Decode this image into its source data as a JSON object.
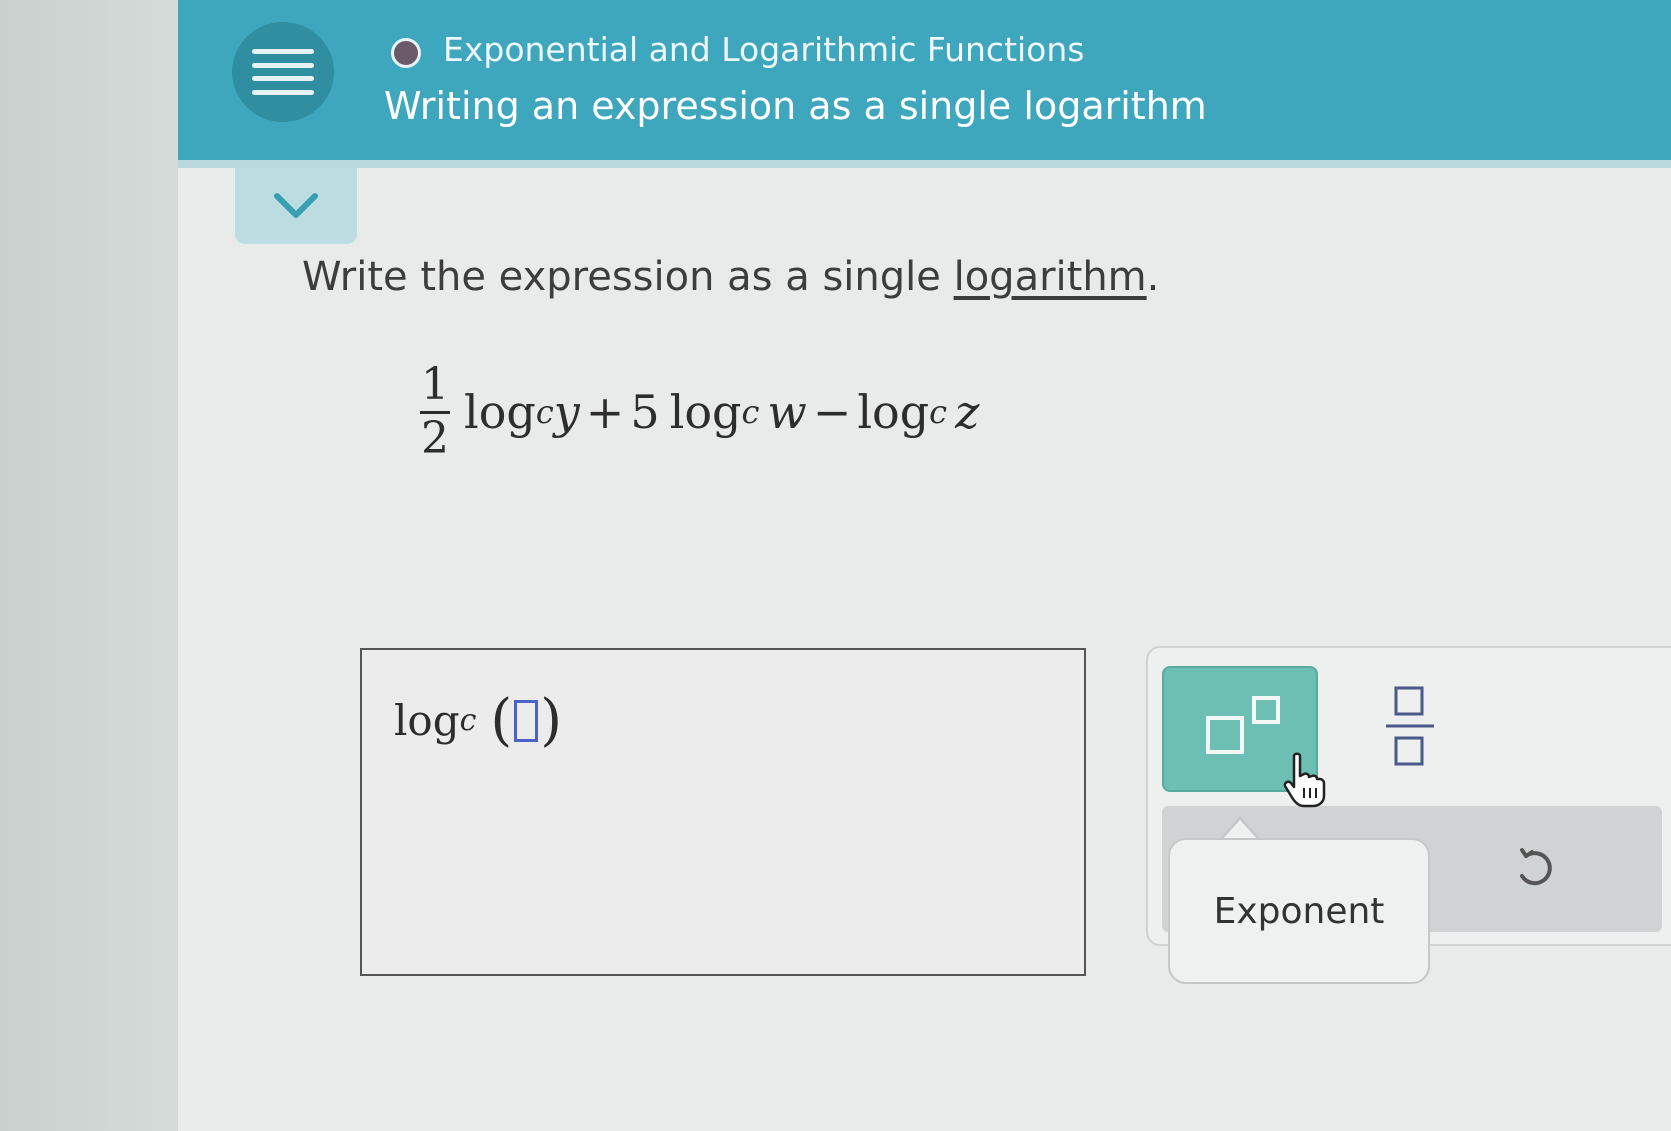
{
  "header": {
    "topic": "Exponential and Logarithmic Functions",
    "title": "Writing an expression as a single logarithm",
    "colors": {
      "bar": "#3ea7bd",
      "menu": "#2f8e9f",
      "dot": "#6b5a6a"
    }
  },
  "icons": {
    "menu": "hamburger-menu-icon",
    "collapse": "chevron-down-icon",
    "undo": "undo-icon",
    "cursor": "hand-pointer-icon"
  },
  "problem": {
    "instruction_prefix": "Write the expression as a single ",
    "instruction_link": "logarithm",
    "instruction_suffix": ".",
    "expression": {
      "frac_num": "1",
      "frac_den": "2",
      "log1": "log",
      "base1": "c",
      "var1": "y",
      "op1": "+",
      "coef2": "5",
      "log2": "log",
      "base2": "c",
      "var2": "w",
      "op2": "−",
      "log3": "log",
      "base3": "c",
      "var3": "z"
    }
  },
  "answer": {
    "log": "log",
    "base": "c",
    "open_paren": "(",
    "close_paren": ")"
  },
  "toolbar": {
    "exponent_tooltip": "Exponent",
    "accent": "#6dbfb4"
  }
}
